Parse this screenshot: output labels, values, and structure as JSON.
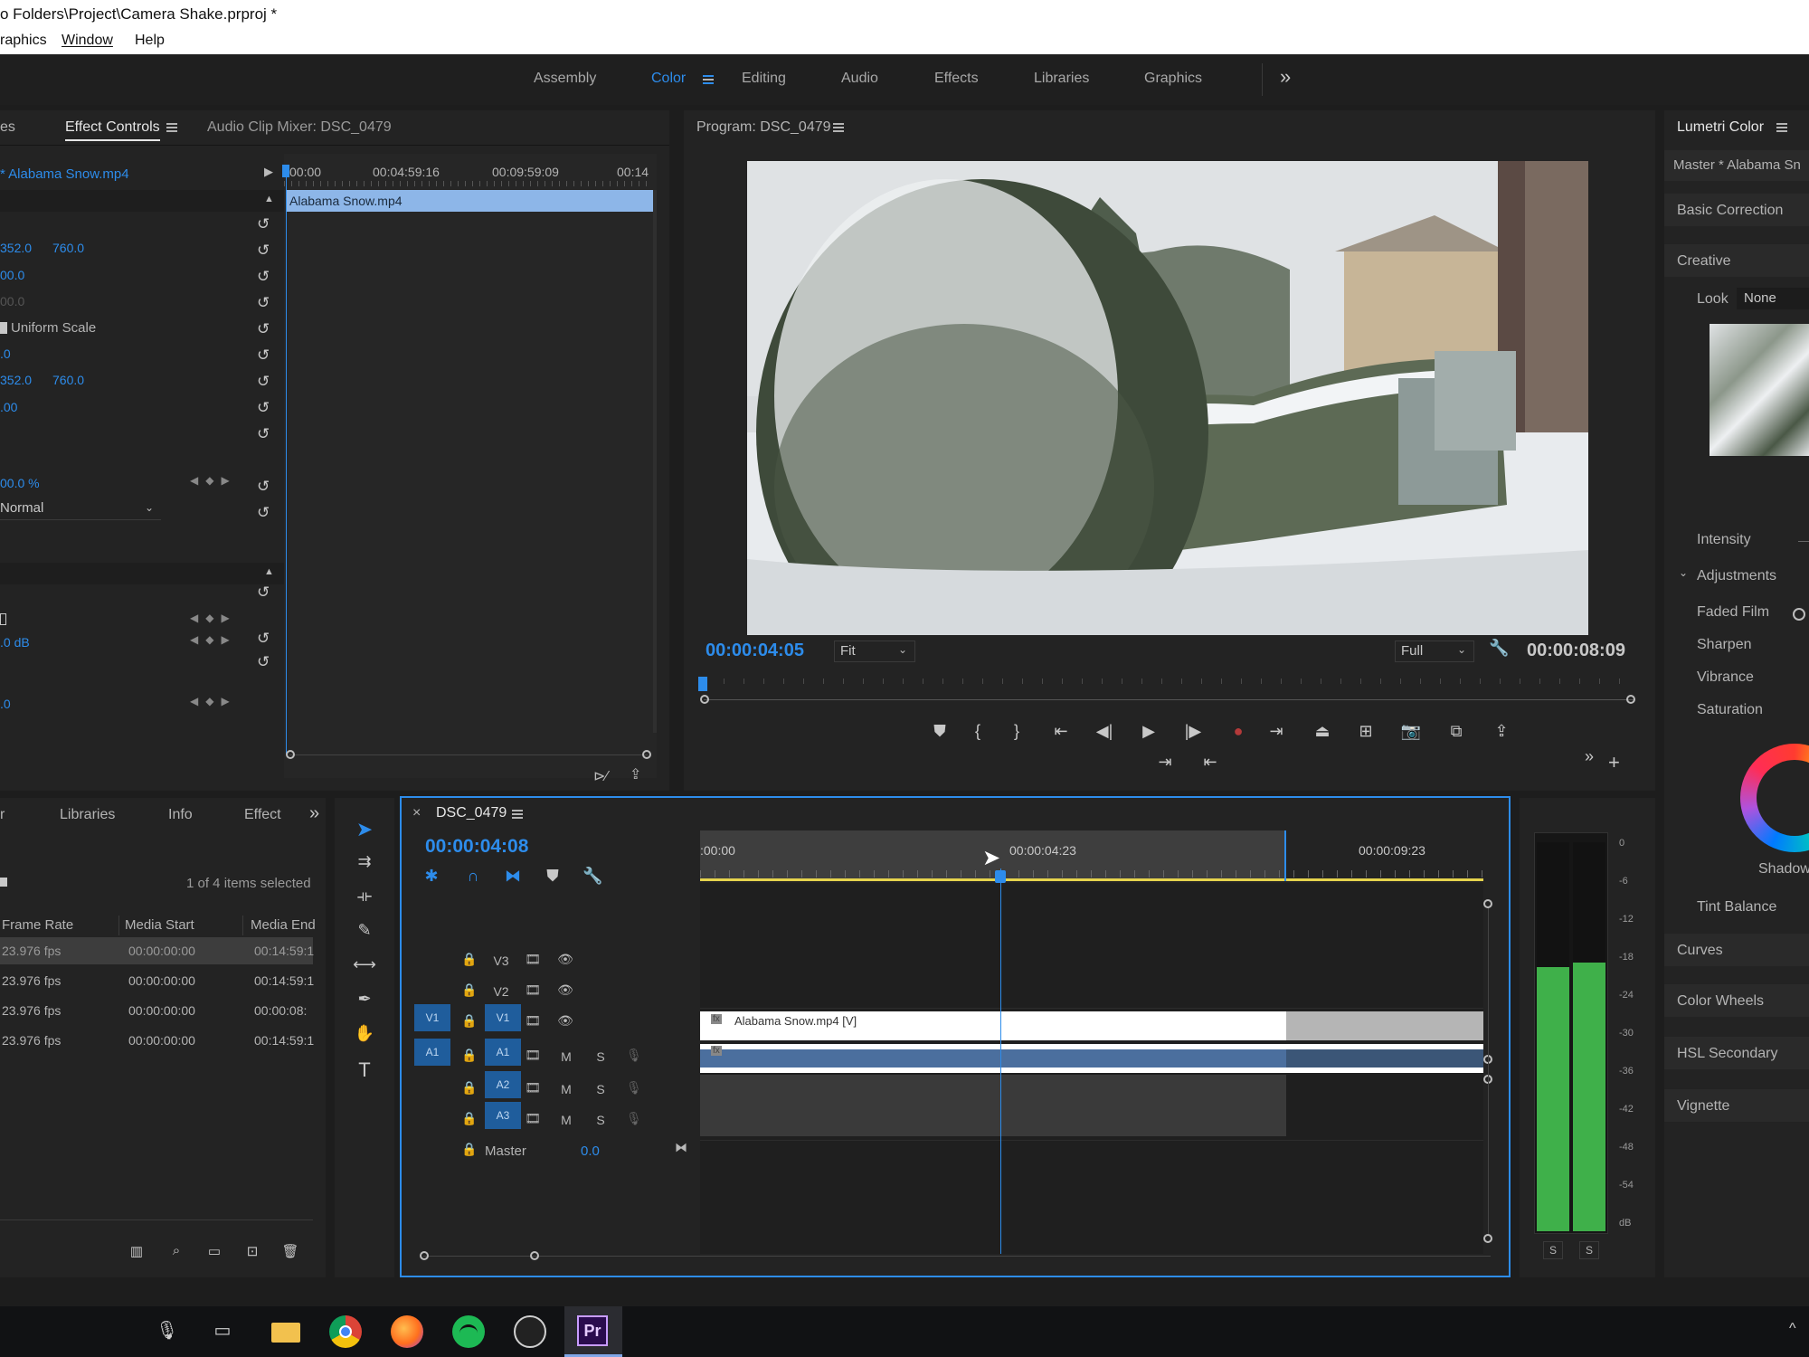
{
  "window": {
    "title": "o Folders\\Project\\Camera Shake.prproj *"
  },
  "menu": {
    "items": [
      "raphics",
      "Window",
      "Help"
    ]
  },
  "workspaces": {
    "tabs": [
      "Assembly",
      "Color",
      "Editing",
      "Audio",
      "Effects",
      "Libraries",
      "Graphics"
    ],
    "active": "Color",
    "more": "»"
  },
  "effect_controls": {
    "tab_prev": "es",
    "tab_active": "Effect Controls",
    "tab_mixer": "Audio Clip Mixer: DSC_0479",
    "clip_name": "* Alabama Snow.mp4",
    "ruler": [
      "00:00",
      "00:04:59:16",
      "00:09:59:09",
      "00:14"
    ],
    "clip_bar": "Alabama Snow.mp4",
    "values": {
      "pos_x": "352.0",
      "pos_y": "760.0",
      "scale": "00.0",
      "scale_w": "00.0",
      "uniform_scale": "Uniform Scale",
      "rotation": ".0",
      "anchor_x": "352.0",
      "anchor_y": "760.0",
      "flicker": ".00",
      "opacity": "00.0 %",
      "blend_mode": "Normal",
      "volume": ".0 dB",
      "panner": ".0"
    }
  },
  "program_monitor": {
    "title": "Program: DSC_0479",
    "timecode": "00:00:04:05",
    "fit": "Fit",
    "quality": "Full",
    "duration": "00:00:08:09",
    "more": "»",
    "add": "+"
  },
  "lumetri": {
    "title": "Lumetri Color",
    "master": "Master * Alabama Sn",
    "basic": "Basic Correction",
    "creative": "Creative",
    "look_label": "Look",
    "look_value": "None",
    "intensity": "Intensity",
    "adjustments": "Adjustments",
    "faded_film": "Faded Film",
    "sharpen": "Sharpen",
    "vibrance": "Vibrance",
    "saturation": "Saturation",
    "shadow": "Shadow",
    "tint_balance": "Tint Balance",
    "curves": "Curves",
    "color_wheels": "Color Wheels",
    "hsl": "HSL Secondary",
    "vignette": "Vignette"
  },
  "project": {
    "tabs": [
      "r",
      "Libraries",
      "Info",
      "Effect"
    ],
    "more": "»",
    "selection": "1 of 4 items selected",
    "columns": [
      "Frame Rate",
      "Media Start",
      "Media End"
    ],
    "rows": [
      [
        "23.976 fps",
        "00:00:00:00",
        "00:14:59:1"
      ],
      [
        "23.976 fps",
        "00:00:00:00",
        "00:14:59:1"
      ],
      [
        "23.976 fps",
        "00:00:00:00",
        "00:00:08:"
      ],
      [
        "23.976 fps",
        "00:00:00:00",
        "00:14:59:1"
      ]
    ]
  },
  "timeline": {
    "close": "×",
    "title": "DSC_0479",
    "timecode": "00:00:04:08",
    "ruler": [
      ":00:00",
      "00:00:04:23",
      "00:00:09:23"
    ],
    "tracks": {
      "v3": "V3",
      "v2": "V2",
      "v1": "V1",
      "v1_src": "V1",
      "a1": "A1",
      "a1_src": "A1",
      "a2": "A2",
      "a3": "A3",
      "m": "M",
      "s": "S",
      "master": "Master",
      "master_val": "0.0"
    },
    "video_clip": "Alabama Snow.mp4 [V]",
    "fx": "fx"
  },
  "audio_meter": {
    "scale": [
      "0",
      "-6",
      "-12",
      "-18",
      "-24",
      "-30",
      "-36",
      "-42",
      "-48",
      "-54",
      "dB"
    ],
    "solo": [
      "S",
      "S"
    ],
    "left_level": 0.68,
    "right_level": 0.69
  },
  "colors": {
    "accent": "#2d8ceb",
    "clip_video": "#ffffff",
    "clip_audio": "#4b6f9e",
    "meter": "#3fb04a"
  }
}
